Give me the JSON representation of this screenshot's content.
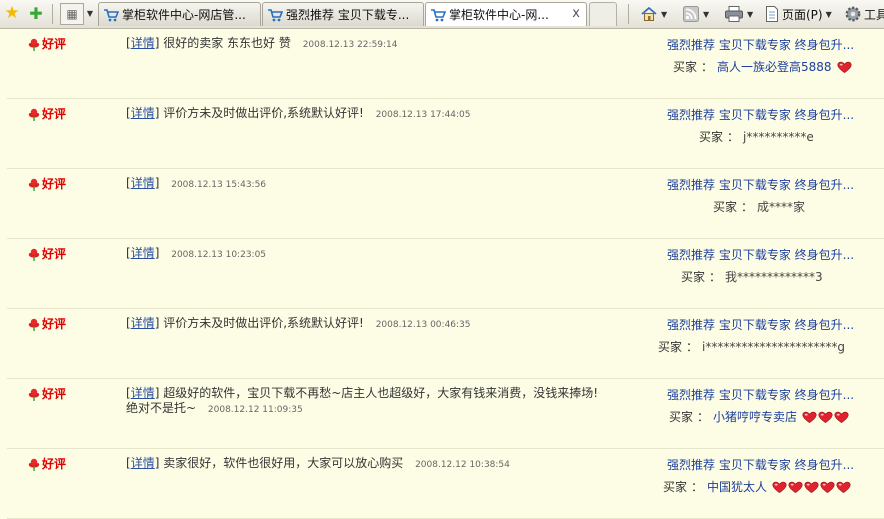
{
  "toolbar": {
    "tabs": [
      {
        "label": "掌柜软件中心-网店管..."
      },
      {
        "label": "强烈推荐 宝贝下载专..."
      },
      {
        "label": "掌柜软件中心-网..."
      }
    ],
    "close_glyph": "x",
    "page_menu": "页面(P)",
    "tools_menu": "工具",
    "icons": [
      "favorites-star-icon",
      "add-favorite-icon",
      "quick-tabs-icon",
      "tab-list-dropdown-icon",
      "home-icon",
      "rss-feed-icon",
      "print-icon",
      "page-icon",
      "gear-icon"
    ]
  },
  "colors": {
    "background": "#fdfde6",
    "rating_red": "#e00000",
    "link_blue": "#1d3f9c"
  },
  "feedback": {
    "rows": [
      {
        "rating": "好评",
        "detail": "详情",
        "comment": "很好的卖家 东东也好 赞",
        "comment2": "",
        "date": "2008.12.13 22:59:14",
        "product": "强烈推荐 宝贝下载专家 终身包升...",
        "buyer_label": "买家",
        "sep": "：",
        "buyer": "高人一族必登高5888",
        "buyer_link": true,
        "hearts": 1
      },
      {
        "rating": "好评",
        "detail": "详情",
        "comment": "评价方未及时做出评价,系统默认好评!",
        "comment2": "",
        "date": "2008.12.13 17:44:05",
        "product": "强烈推荐 宝贝下载专家 终身包升...",
        "buyer_label": "买家",
        "sep": "：",
        "buyer": "j**********e",
        "buyer_link": false,
        "hearts": 0
      },
      {
        "rating": "好评",
        "detail": "详情",
        "comment": "",
        "comment2": "",
        "date": "2008.12.13 15:43:56",
        "product": "强烈推荐 宝贝下载专家 终身包升...",
        "buyer_label": "买家",
        "sep": "：",
        "buyer": "成****家",
        "buyer_link": false,
        "hearts": 0
      },
      {
        "rating": "好评",
        "detail": "详情",
        "comment": "",
        "comment2": "",
        "date": "2008.12.13 10:23:05",
        "product": "强烈推荐 宝贝下载专家 终身包升...",
        "buyer_label": "买家",
        "sep": "：",
        "buyer": "我*************3",
        "buyer_link": false,
        "hearts": 0
      },
      {
        "rating": "好评",
        "detail": "详情",
        "comment": "评价方未及时做出评价,系统默认好评!",
        "comment2": "",
        "date": "2008.12.13 00:46:35",
        "product": "强烈推荐 宝贝下载专家 终身包升...",
        "buyer_label": "买家",
        "sep": "：",
        "buyer": "i**********************g",
        "buyer_link": false,
        "hearts": 0
      },
      {
        "rating": "好评",
        "detail": "详情",
        "comment": "超级好的软件，宝贝下载不再愁~店主人也超级好，大家有钱来消费，没钱来捧场!",
        "comment2": "绝对不是托~",
        "date": "2008.12.12 11:09:35",
        "product": "强烈推荐 宝贝下载专家 终身包升...",
        "buyer_label": "买家",
        "sep": "：",
        "buyer": "小猪哼哼专卖店",
        "buyer_link": true,
        "hearts": 3
      },
      {
        "rating": "好评",
        "detail": "详情",
        "comment": "卖家很好，软件也很好用，大家可以放心购买",
        "comment2": "",
        "date": "2008.12.12 10:38:54",
        "product": "强烈推荐 宝贝下载专家 终身包升...",
        "buyer_label": "买家",
        "sep": "：",
        "buyer": "中国犹太人",
        "buyer_link": true,
        "hearts": 5
      }
    ]
  }
}
